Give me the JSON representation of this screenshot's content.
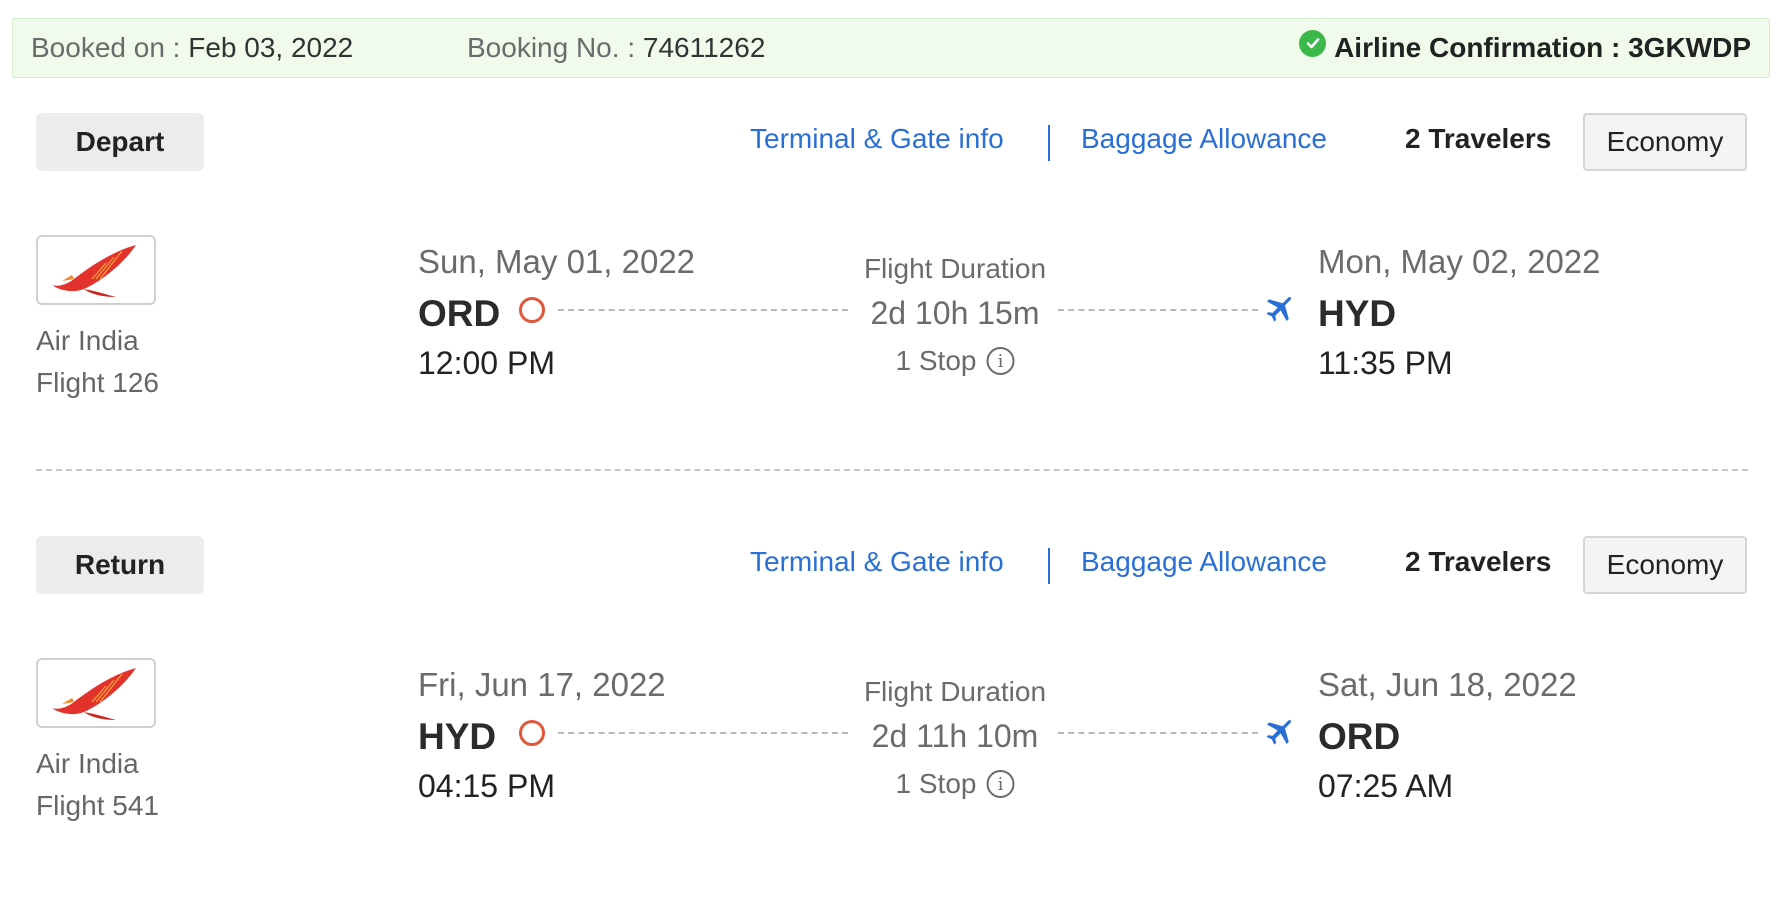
{
  "booking": {
    "booked_label": "Booked on :",
    "booked_date": "Feb 03, 2022",
    "booking_no_label": "Booking No. :",
    "booking_no": "74611262",
    "confirmation_label": "Airline Confirmation :",
    "confirmation_code": "3GKWDP"
  },
  "links": {
    "terminal": "Terminal & Gate info",
    "baggage": "Baggage Allowance"
  },
  "colors": {
    "link": "#2a6fd6",
    "origin_ring": "#e0573a",
    "success": "#3cb84a",
    "banner_bg": "#f0fbec"
  },
  "segments": [
    {
      "type_label": "Depart",
      "travelers": "2 Travelers",
      "cabin": "Economy",
      "airline": "Air India",
      "flight": "Flight 126",
      "departure": {
        "date": "Sun, May 01, 2022",
        "code": "ORD",
        "time": "12:00 PM"
      },
      "duration_label": "Flight Duration",
      "duration": "2d 10h 15m",
      "stops": "1 Stop",
      "arrival": {
        "date": "Mon, May 02, 2022",
        "code": "HYD",
        "time": "11:35 PM"
      }
    },
    {
      "type_label": "Return",
      "travelers": "2 Travelers",
      "cabin": "Economy",
      "airline": "Air India",
      "flight": "Flight 541",
      "departure": {
        "date": "Fri, Jun 17, 2022",
        "code": "HYD",
        "time": "04:15 PM"
      },
      "duration_label": "Flight Duration",
      "duration": "2d 11h 10m",
      "stops": "1 Stop",
      "arrival": {
        "date": "Sat, Jun 18, 2022",
        "code": "ORD",
        "time": "07:25 AM"
      }
    }
  ],
  "icons": [
    "check-circle-icon",
    "air-india-logo",
    "origin-circle-icon",
    "info-icon",
    "plane-icon"
  ]
}
